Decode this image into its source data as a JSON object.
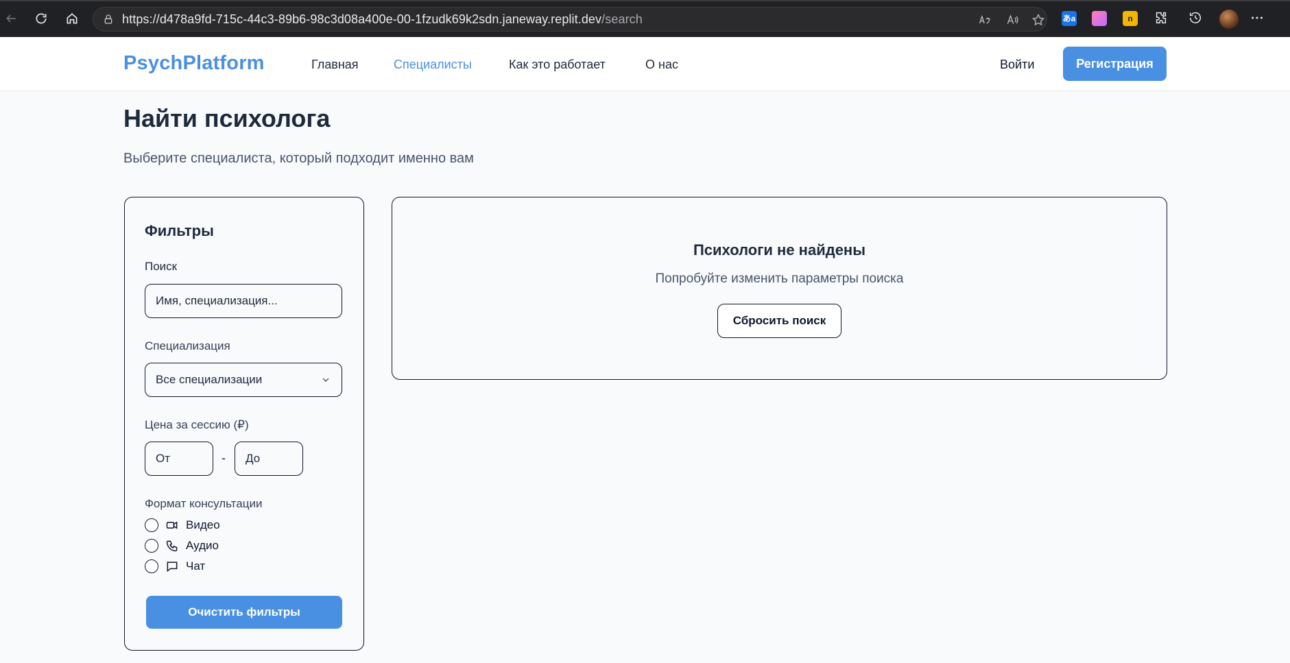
{
  "browser": {
    "url_host": "https://d478a9fd-715c-44c3-89b6-98c3d08a400e-00-1fzudk69k2sdn.janeway.replit.dev",
    "url_path": "/search",
    "ext_translate_label": "あa",
    "ext_yellow_label": "n"
  },
  "header": {
    "logo": "PsychPlatform",
    "nav": [
      "Главная",
      "Специалисты",
      "Как это работает",
      "О нас"
    ],
    "active_nav": "Специалисты",
    "login": "Войти",
    "register": "Регистрация"
  },
  "page": {
    "title": "Найти психолога",
    "subtitle": "Выберите специалиста, который подходит именно вам"
  },
  "filters": {
    "title": "Фильтры",
    "search_label": "Поиск",
    "search_placeholder": "Имя, специализация...",
    "specialization_label": "Специализация",
    "specialization_value": "Все специализации",
    "price_label": "Цена за сессию (₽)",
    "price_from_placeholder": "От",
    "price_separator": "-",
    "price_to_placeholder": "До",
    "format_label": "Формат консультации",
    "formats": [
      {
        "label": "Видео",
        "icon": "video-icon",
        "checked": false
      },
      {
        "label": "Аудио",
        "icon": "phone-icon",
        "checked": false
      },
      {
        "label": "Чат",
        "icon": "chat-icon",
        "checked": false
      }
    ],
    "clear_button": "Очистить фильтры"
  },
  "results": {
    "empty_title": "Психологи не найдены",
    "empty_subtitle": "Попробуйте изменить параметры поиска",
    "reset_button": "Сбросить поиск"
  },
  "colors": {
    "brand": "#4a90e2",
    "text": "#1e293b",
    "background": "#f8fafc"
  }
}
